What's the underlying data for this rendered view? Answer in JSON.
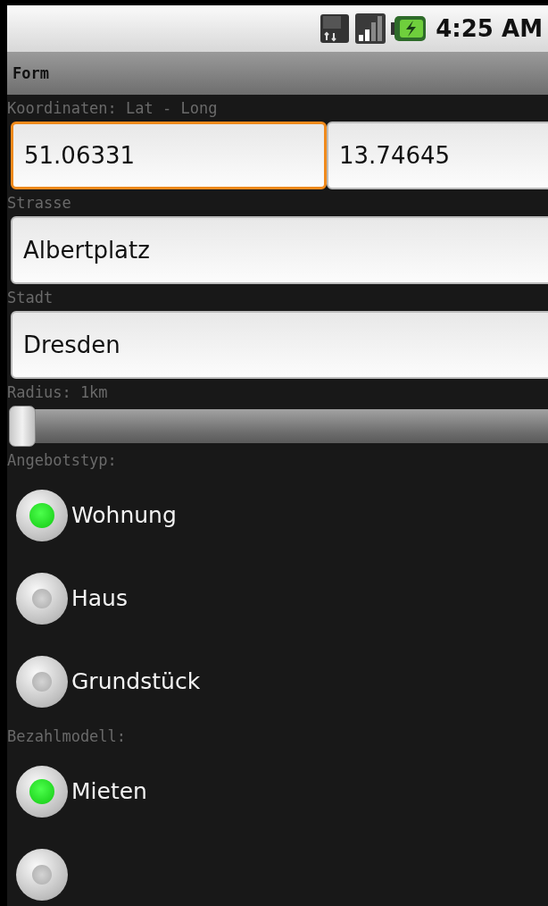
{
  "status_bar": {
    "time": "4:25 AM"
  },
  "title_bar": {
    "title": "Form"
  },
  "coordinates": {
    "label": "Koordinaten: Lat - Long",
    "fields": [
      {
        "value": "51.06331",
        "focused": true
      },
      {
        "value": "13.74645",
        "focused": false
      }
    ]
  },
  "street": {
    "label": "Strasse",
    "value": "Albertplatz"
  },
  "city": {
    "label": "Stadt",
    "value": "Dresden"
  },
  "radius": {
    "label": "Radius: 1km",
    "level": 0
  },
  "offer_type": {
    "label": "Angebotstyp:",
    "options": [
      {
        "label": "Wohnung",
        "selected": true
      },
      {
        "label": "Haus",
        "selected": false
      },
      {
        "label": "Grundstück",
        "selected": false
      }
    ]
  },
  "payment_model": {
    "label": "Bezahlmodell:",
    "options": [
      {
        "label": "Mieten",
        "selected": true
      },
      {
        "selected": false
      }
    ]
  }
}
